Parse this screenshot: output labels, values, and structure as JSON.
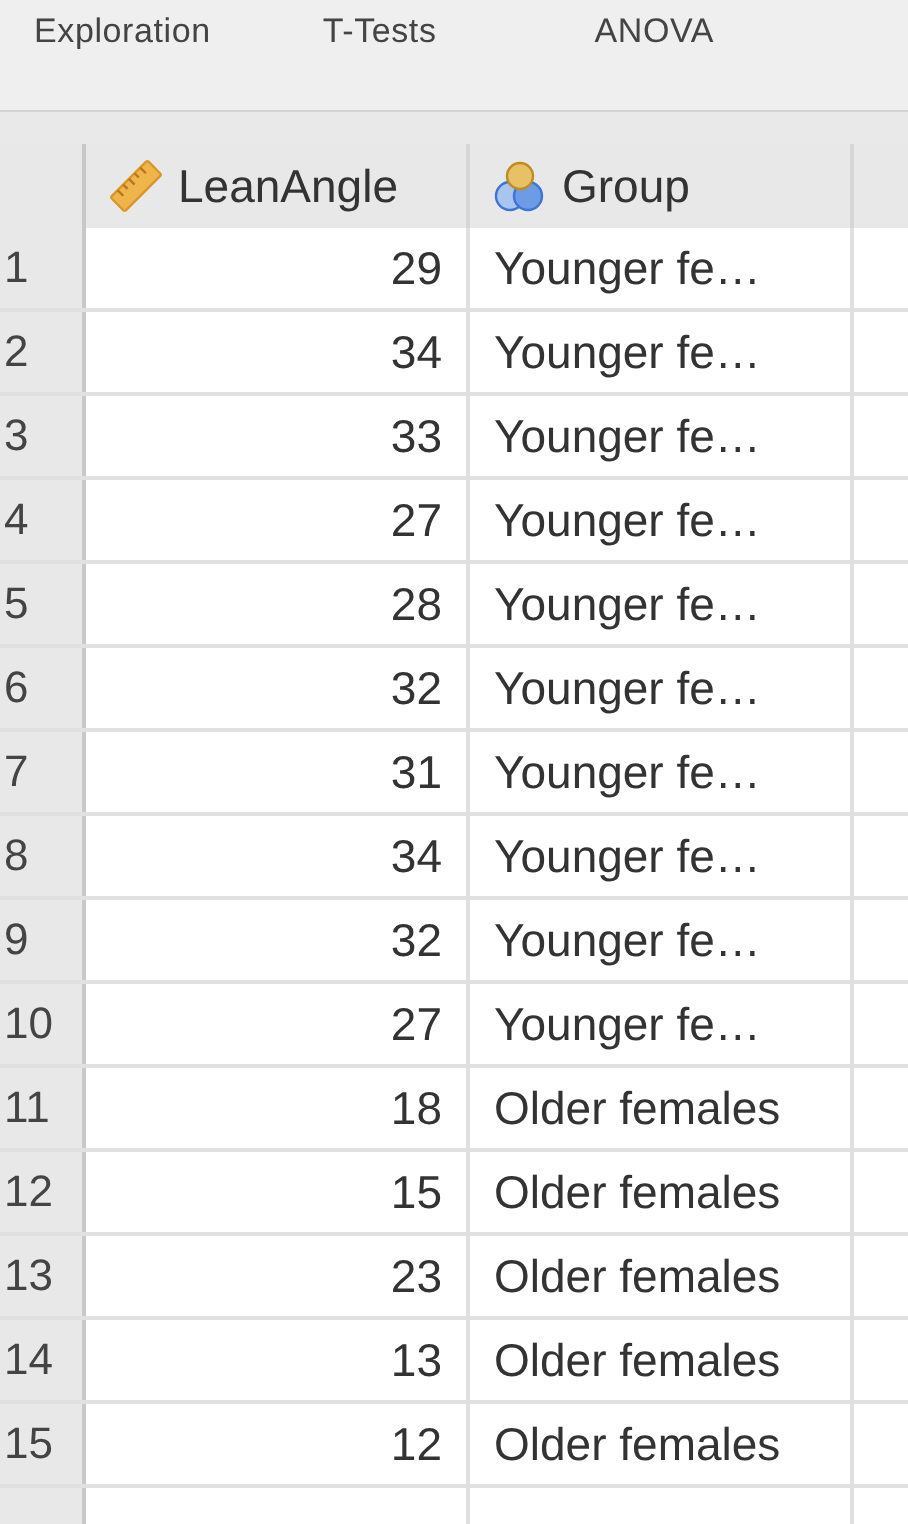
{
  "tabs": [
    {
      "label": "Exploration"
    },
    {
      "label": "T-Tests"
    },
    {
      "label": "ANOVA"
    }
  ],
  "columns": [
    {
      "name": "LeanAngle",
      "kind": "scale"
    },
    {
      "name": "Group",
      "kind": "nominal"
    }
  ],
  "rows": [
    {
      "number": "1",
      "lean_angle": "29",
      "group": "Younger fe…"
    },
    {
      "number": "2",
      "lean_angle": "34",
      "group": "Younger fe…"
    },
    {
      "number": "3",
      "lean_angle": "33",
      "group": "Younger fe…"
    },
    {
      "number": "4",
      "lean_angle": "27",
      "group": "Younger fe…"
    },
    {
      "number": "5",
      "lean_angle": "28",
      "group": "Younger fe…"
    },
    {
      "number": "6",
      "lean_angle": "32",
      "group": "Younger fe…"
    },
    {
      "number": "7",
      "lean_angle": "31",
      "group": "Younger fe…"
    },
    {
      "number": "8",
      "lean_angle": "34",
      "group": "Younger fe…"
    },
    {
      "number": "9",
      "lean_angle": "32",
      "group": "Younger fe…"
    },
    {
      "number": "10",
      "lean_angle": "27",
      "group": "Younger fe…"
    },
    {
      "number": "11",
      "lean_angle": "18",
      "group": "Older females"
    },
    {
      "number": "12",
      "lean_angle": "15",
      "group": "Older females"
    },
    {
      "number": "13",
      "lean_angle": "23",
      "group": "Older females"
    },
    {
      "number": "14",
      "lean_angle": "13",
      "group": "Older females"
    },
    {
      "number": "15",
      "lean_angle": "12",
      "group": "Older females"
    }
  ]
}
